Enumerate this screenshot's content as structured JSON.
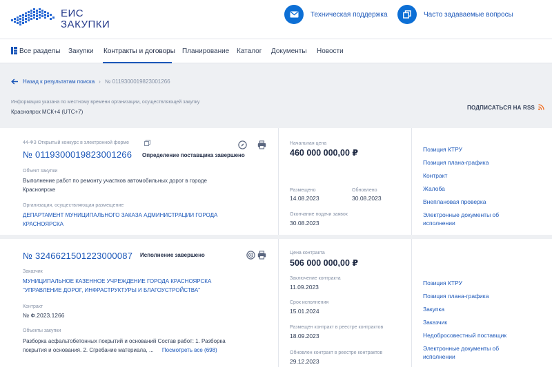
{
  "header": {
    "logo_line1": "ЕИС",
    "logo_line2": "ЗАКУПКИ",
    "support_label": "Техническая поддержка",
    "faq_label": "Часто задаваемые вопросы"
  },
  "nav": {
    "items": [
      "Все разделы",
      "Закупки",
      "Контракты и договоры",
      "Планирование",
      "Каталог",
      "Документы",
      "Новости"
    ],
    "active": "Контракты и договоры"
  },
  "breadcrumb": {
    "back": "Назад к результатам поиска",
    "current": "№ 0119300019823001266"
  },
  "timezone": {
    "note": "Информация указана по местному времени организации, осуществляющей закупку",
    "value": "Красноярск МСК+4 (UTC+7)"
  },
  "rss_label": "ПОДПИСАТЬСЯ НА RSS",
  "colors": {
    "accent": "#1a56b8",
    "brand_blue": "#0d6fd5",
    "rss": "#f26b1d"
  },
  "card1": {
    "law": "44-ФЗ Открытый конкурс в электронной форме",
    "number": "№ 0119300019823001266",
    "status": "Определение поставщика завершено",
    "object_label": "Объект закупки",
    "object_line1": "Выполнение работ по ремонту участков автомобильных дорог в городе",
    "object_line2": "Красноярске",
    "org_label": "Организация, осуществляющая размещение",
    "org_line1": "ДЕПАРТАМЕНТ МУНИЦИПАЛЬНОГО ЗАКАЗА АДМИНИСТРАЦИИ ГОРОДА",
    "org_line2": "КРАСНОЯРСКА",
    "price_label": "Начальная цена",
    "price": "460 000 000,00 ₽",
    "posted_label": "Размещено",
    "posted": "14.08.2023",
    "updated_label": "Обновлено",
    "updated": "30.08.2023",
    "deadline_label": "Окончание подачи заявок",
    "deadline": "30.08.2023",
    "links": [
      "Позиция КТРУ",
      "Позиция плана-графика",
      "Контракт",
      "Жалоба",
      "Внеплановая проверка",
      "Электронные документы об",
      "исполнении"
    ]
  },
  "card2": {
    "number": "№ 3246621501223000087",
    "status": "Исполнение завершено",
    "customer_label": "Заказчик",
    "customer_line1": "МУНИЦИПАЛЬНОЕ КАЗЕННОЕ УЧРЕЖДЕНИЕ ГОРОДА КРАСНОЯРСКА",
    "customer_line2": "\"УПРАВЛЕНИЕ ДОРОГ, ИНФРАСТРУКТУРЫ И БЛАГОУСТРОЙСТВА\"",
    "contract_label": "Контракт",
    "contract": "№ Ф.2023.1266",
    "objects_label": "Объекты закупки",
    "objects_line1": "Разборка асфальтобетонных покрытий и оснований Состав работ: 1. Разборка",
    "objects_line2": "покрытия и основания. 2. Сгребание материала, ...",
    "objects_more": "Посмотреть все (698)",
    "price_label": "Цена контракта",
    "price": "506 000 000,00 ₽",
    "concluded_label": "Заключение контракта",
    "concluded": "11.09.2023",
    "term_label": "Срок исполнения",
    "term": "15.01.2024",
    "registered_label": "Размещен контракт в реестре контрактов",
    "registered": "18.09.2023",
    "updated_label": "Обновлен контракт в реестре контрактов",
    "updated": "29.12.2023",
    "links": [
      "Позиция КТРУ",
      "Позиция плана-графика",
      "Закупка",
      "Заказчик",
      "Недобросовестный поставщик",
      "Электронные документы об",
      "исполнении"
    ]
  }
}
